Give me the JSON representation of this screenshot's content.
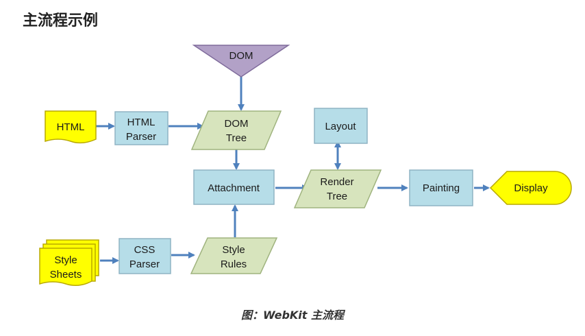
{
  "title": "主流程示例",
  "caption": "图：WebKit 主流程",
  "colors": {
    "blue_fill": "#b6dde8",
    "blue_stroke": "#8fb4c4",
    "green_fill": "#d7e4bd",
    "green_stroke": "#9fb37e",
    "yellow_fill": "#ffff00",
    "yellow_stroke": "#b8a800",
    "purple_fill": "#b2a1c7",
    "arrow": "#4f81bd"
  },
  "nodes": {
    "dom": {
      "label": "DOM"
    },
    "html_doc": {
      "label": "HTML"
    },
    "html_parser": {
      "line1": "HTML",
      "line2": "Parser"
    },
    "dom_tree": {
      "line1": "DOM",
      "line2": "Tree"
    },
    "layout": {
      "label": "Layout"
    },
    "attachment": {
      "label": "Attachment"
    },
    "render_tree": {
      "line1": "Render",
      "line2": "Tree"
    },
    "painting": {
      "label": "Painting"
    },
    "display": {
      "label": "Display"
    },
    "style_sheets": {
      "line1": "Style",
      "line2": "Sheets"
    },
    "css_parser": {
      "line1": "CSS",
      "line2": "Parser"
    },
    "style_rules": {
      "line1": "Style",
      "line2": "Rules"
    }
  }
}
